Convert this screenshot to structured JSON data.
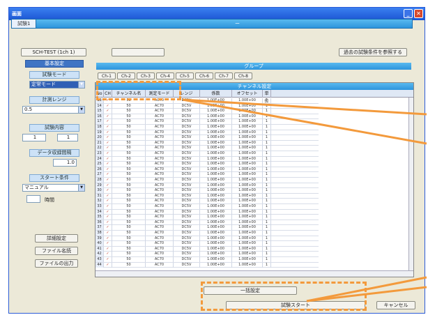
{
  "window": {
    "title": "画面"
  },
  "tab_bar": {
    "active_tab": "試験1",
    "center_text": "ー"
  },
  "top_buttons": {
    "config_label": "SCH-TEST (1ch 1)",
    "second_label": "",
    "right_label": "過去の試験条件を参照する"
  },
  "left_panel": {
    "section_title": "基本設定",
    "test_mode_label": "試験モード",
    "test_mode_value": "定常モード",
    "range_label": "計測レンジ",
    "range_value": "0.5",
    "content_label": "試験内容",
    "content_value1": "1",
    "content_value2": "1",
    "interval_label": "データ収録間隔",
    "interval_value": "1.0",
    "start_label": "スタート条件",
    "start_value": "マニュアル",
    "start_time_label": "時間",
    "detail_button": "詳細設定",
    "file_button": "ファイル名読",
    "trigger_button": "ファイルの出力"
  },
  "group_bar": {
    "label": "グループ"
  },
  "group_tabs": [
    "Ch-1",
    "Ch-2",
    "Ch-3",
    "Ch-4",
    "Ch-5",
    "Ch-6",
    "Ch-7",
    "Ch-8"
  ],
  "grid": {
    "title": "チャンネル設定",
    "headers": [
      "No",
      "CH",
      "チャンネル名",
      "測定モード",
      "レンジ",
      "係数",
      "オフセット",
      "単位"
    ],
    "rows": [
      [
        "13",
        "✓",
        "50",
        "AC70",
        "DC5V",
        "1.00E+00",
        "1.00E+00",
        "1"
      ],
      [
        "14",
        "✓",
        "50",
        "AC70",
        "DC5V",
        "1.00E+00",
        "1.00E+00",
        "1"
      ],
      [
        "15",
        "✓",
        "50",
        "AC70",
        "DC5V",
        "1.00E+00",
        "1.00E+00",
        "1"
      ],
      [
        "16",
        "✓",
        "50",
        "AC70",
        "DC5V",
        "1.00E+00",
        "1.00E+00",
        "1"
      ],
      [
        "17",
        "✓",
        "50",
        "AC70",
        "DC5V",
        "1.00E+00",
        "1.00E+00",
        "1"
      ],
      [
        "18",
        "✓",
        "50",
        "AC70",
        "DC5V",
        "1.00E+00",
        "1.00E+00",
        "1"
      ],
      [
        "19",
        "✓",
        "50",
        "AC70",
        "DC5V",
        "1.00E+00",
        "1.00E+00",
        "1"
      ],
      [
        "20",
        "✓",
        "50",
        "AC70",
        "DC5V",
        "1.00E+00",
        "1.00E+00",
        "1"
      ],
      [
        "21",
        "✓",
        "50",
        "AC70",
        "DC5V",
        "1.00E+00",
        "1.00E+00",
        "1"
      ],
      [
        "22",
        "✓",
        "50",
        "AC70",
        "DC5V",
        "1.00E+00",
        "1.00E+00",
        "1"
      ],
      [
        "23",
        "✓",
        "50",
        "AC70",
        "DC5V",
        "1.00E+00",
        "1.00E+00",
        "1"
      ],
      [
        "24",
        "✓",
        "50",
        "AC70",
        "DC5V",
        "1.00E+00",
        "1.00E+00",
        "1"
      ],
      [
        "25",
        "✓",
        "50",
        "AC70",
        "DC5V",
        "1.00E+00",
        "1.00E+00",
        "1"
      ],
      [
        "26",
        "✓",
        "50",
        "AC70",
        "DC5V",
        "1.00E+00",
        "1.00E+00",
        "1"
      ],
      [
        "27",
        "✓",
        "50",
        "AC70",
        "DC5V",
        "1.00E+00",
        "1.00E+00",
        "1"
      ],
      [
        "28",
        "✓",
        "50",
        "AC70",
        "DC5V",
        "1.00E+00",
        "1.00E+00",
        "1"
      ],
      [
        "29",
        "✓",
        "50",
        "AC70",
        "DC5V",
        "1.00E+00",
        "1.00E+00",
        "1"
      ],
      [
        "30",
        "✓",
        "50",
        "AC70",
        "DC5V",
        "1.00E+00",
        "1.00E+00",
        "1"
      ],
      [
        "31",
        "✓",
        "50",
        "AC70",
        "DC5V",
        "1.00E+00",
        "1.00E+00",
        "1"
      ],
      [
        "32",
        "✓",
        "50",
        "AC70",
        "DC5V",
        "1.00E+00",
        "1.00E+00",
        "1"
      ],
      [
        "33",
        "✓",
        "50",
        "AC70",
        "DC5V",
        "1.00E+00",
        "1.00E+00",
        "1"
      ],
      [
        "34",
        "✓",
        "50",
        "AC70",
        "DC5V",
        "1.00E+00",
        "1.00E+00",
        "1"
      ],
      [
        "35",
        "✓",
        "50",
        "AC70",
        "DC5V",
        "1.00E+00",
        "1.00E+00",
        "1"
      ],
      [
        "36",
        "✓",
        "50",
        "AC70",
        "DC5V",
        "1.00E+00",
        "1.00E+00",
        "1"
      ],
      [
        "37",
        "✓",
        "50",
        "AC70",
        "DC5V",
        "1.00E+00",
        "1.00E+00",
        "1"
      ],
      [
        "38",
        "✓",
        "50",
        "AC70",
        "DC5V",
        "1.00E+00",
        "1.00E+00",
        "1"
      ],
      [
        "39",
        "✓",
        "50",
        "AC70",
        "DC5V",
        "1.00E+00",
        "1.00E+00",
        "1"
      ],
      [
        "40",
        "✓",
        "50",
        "AC70",
        "DC5V",
        "1.00E+00",
        "1.00E+00",
        "1"
      ],
      [
        "41",
        "✓",
        "50",
        "AC70",
        "DC5V",
        "1.00E+00",
        "1.00E+00",
        "1"
      ],
      [
        "42",
        "✓",
        "50",
        "AC70",
        "DC5V",
        "1.00E+00",
        "1.00E+00",
        "1"
      ],
      [
        "43",
        "✓",
        "50",
        "AC70",
        "DC5V",
        "1.00E+00",
        "1.00E+00",
        "1"
      ],
      [
        "44",
        "✓",
        "50",
        "AC70",
        "DC5V",
        "1.00E+00",
        "1.00E+00",
        "1"
      ]
    ]
  },
  "bottom": {
    "bulk_button": "一括設定",
    "start_button": "試験スタート",
    "cancel_button": "キャンセル"
  },
  "colors": {
    "highlight": "#f39a3c",
    "accent_blue": "#2d94dc"
  }
}
